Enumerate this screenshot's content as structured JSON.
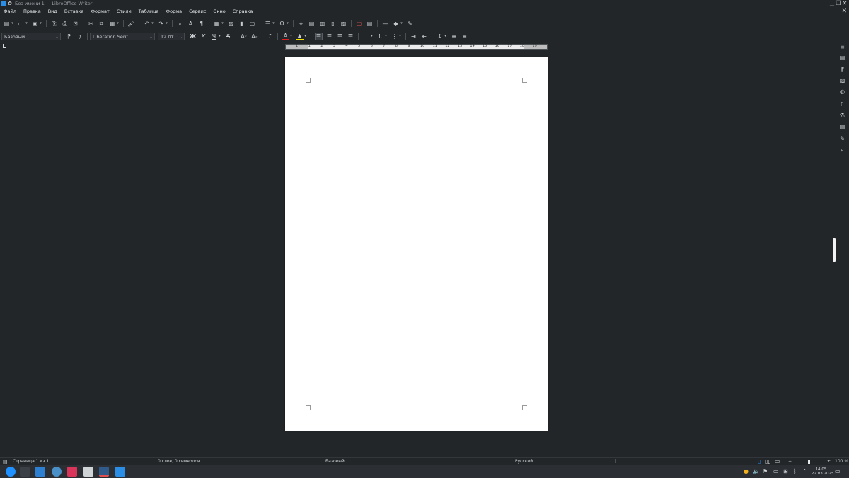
{
  "window": {
    "title": "Без имени 1 — LibreOffice Writer"
  },
  "menu": [
    "Файл",
    "Правка",
    "Вид",
    "Вставка",
    "Формат",
    "Стили",
    "Таблица",
    "Форма",
    "Сервис",
    "Окно",
    "Справка"
  ],
  "formatting": {
    "paragraph_style": "Базовый",
    "font_name": "Liberation Serif",
    "font_size": "12 пт",
    "bold": "Ж",
    "italic": "К",
    "underline": "Ч",
    "strike": "S"
  },
  "ruler": {
    "numbers": [
      "1",
      "1",
      "2",
      "3",
      "4",
      "5",
      "6",
      "7",
      "8",
      "9",
      "10",
      "11",
      "12",
      "13",
      "14",
      "15",
      "16",
      "17",
      "18",
      "19"
    ]
  },
  "status": {
    "page": "Страница 1 из 1",
    "words": "0 слов, 0 символов",
    "page_style": "Базовый",
    "language": "Русский",
    "zoom": "100 %"
  },
  "clock": {
    "time": "14:05",
    "date": "22.03.2025"
  },
  "colors": {
    "background": "#232629",
    "page": "#ffffff",
    "accent": "#2a8de6",
    "font_color_bar": "#e02020",
    "highlight_bar": "#f0e000"
  }
}
